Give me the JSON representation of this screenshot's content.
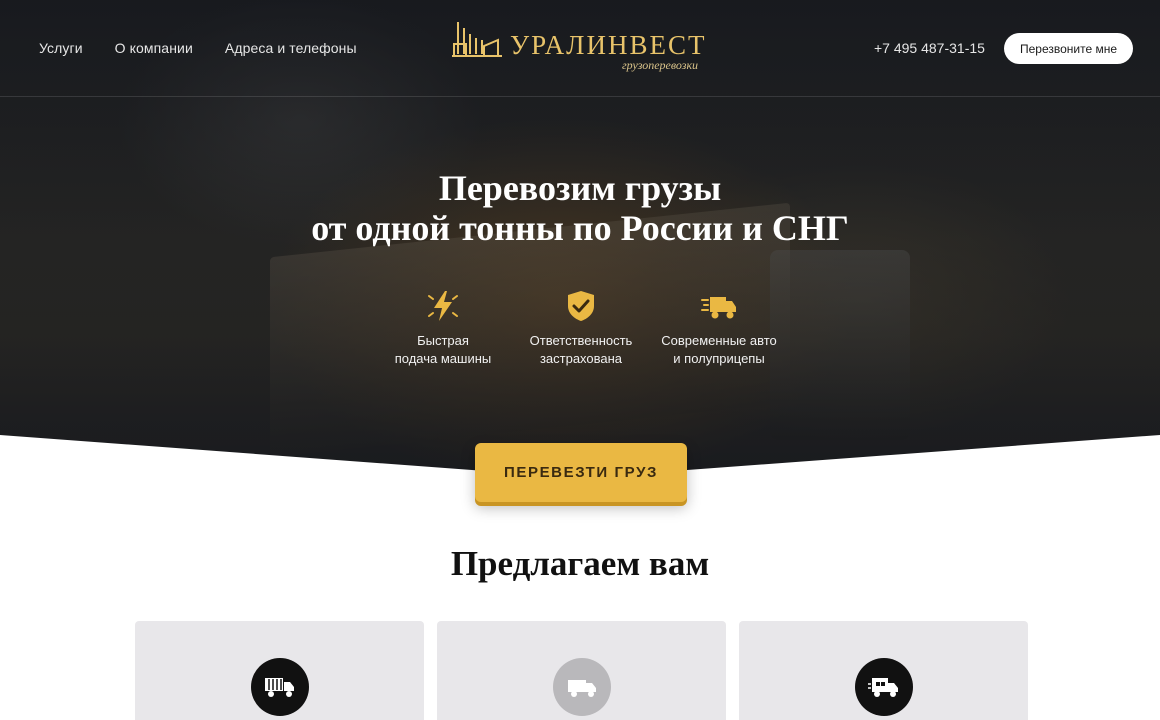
{
  "header": {
    "nav": [
      "Услуги",
      "О компании",
      "Адреса и телефоны"
    ],
    "logo_name": "УРАЛИНВЕСТ",
    "logo_sub": "грузоперевозки",
    "phone": "+7 495 487-31-15",
    "callback_label": "Перезвоните мне"
  },
  "hero": {
    "title_line1": "Перевозим грузы",
    "title_line2": "от одной тонны по России и СНГ",
    "features": [
      {
        "icon": "lightning-icon",
        "line1": "Быстрая",
        "line2": "подача машины"
      },
      {
        "icon": "shield-check-icon",
        "line1": "Ответственность",
        "line2": "застрахована"
      },
      {
        "icon": "fast-truck-icon",
        "line1": "Современные авто",
        "line2": "и полуприцепы"
      }
    ],
    "cta_label": "ПЕРЕВЕЗТИ ГРУЗ"
  },
  "offers": {
    "title": "Предлагаем вам",
    "cards": [
      {
        "icon": "container-truck-icon"
      },
      {
        "icon": "van-icon"
      },
      {
        "icon": "box-truck-icon"
      }
    ]
  },
  "colors": {
    "accent": "#eab843",
    "logo_gold": "#e8c36a",
    "dark": "#111111",
    "card_bg": "#e8e7ea"
  }
}
